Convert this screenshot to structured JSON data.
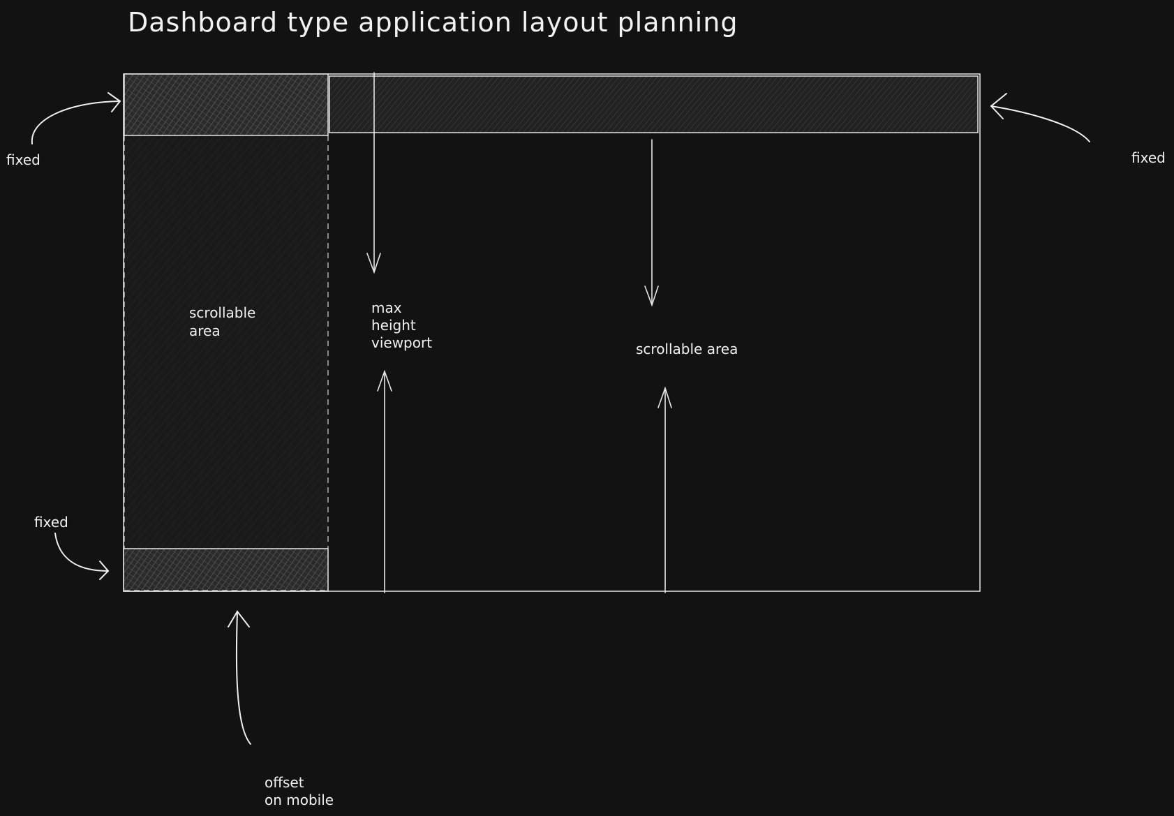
{
  "title": "Dashboard type application layout planning",
  "annotations": {
    "fixed_top_left": "fixed",
    "fixed_top_right": "fixed",
    "fixed_bottom_left": "fixed",
    "sidebar_scroll_line1": "scrollable",
    "sidebar_scroll_line2": "area",
    "max_line1": "max",
    "max_line2": "height",
    "max_line3": "viewport",
    "main_scroll": "scrollable area",
    "offset_line1": "offset",
    "offset_line2": "on mobile"
  },
  "colors": {
    "background": "#121212",
    "stroke": "#e8e8e8",
    "hatch_dense": "#5a5a5a",
    "hatch_light": "#2c2c2c"
  }
}
